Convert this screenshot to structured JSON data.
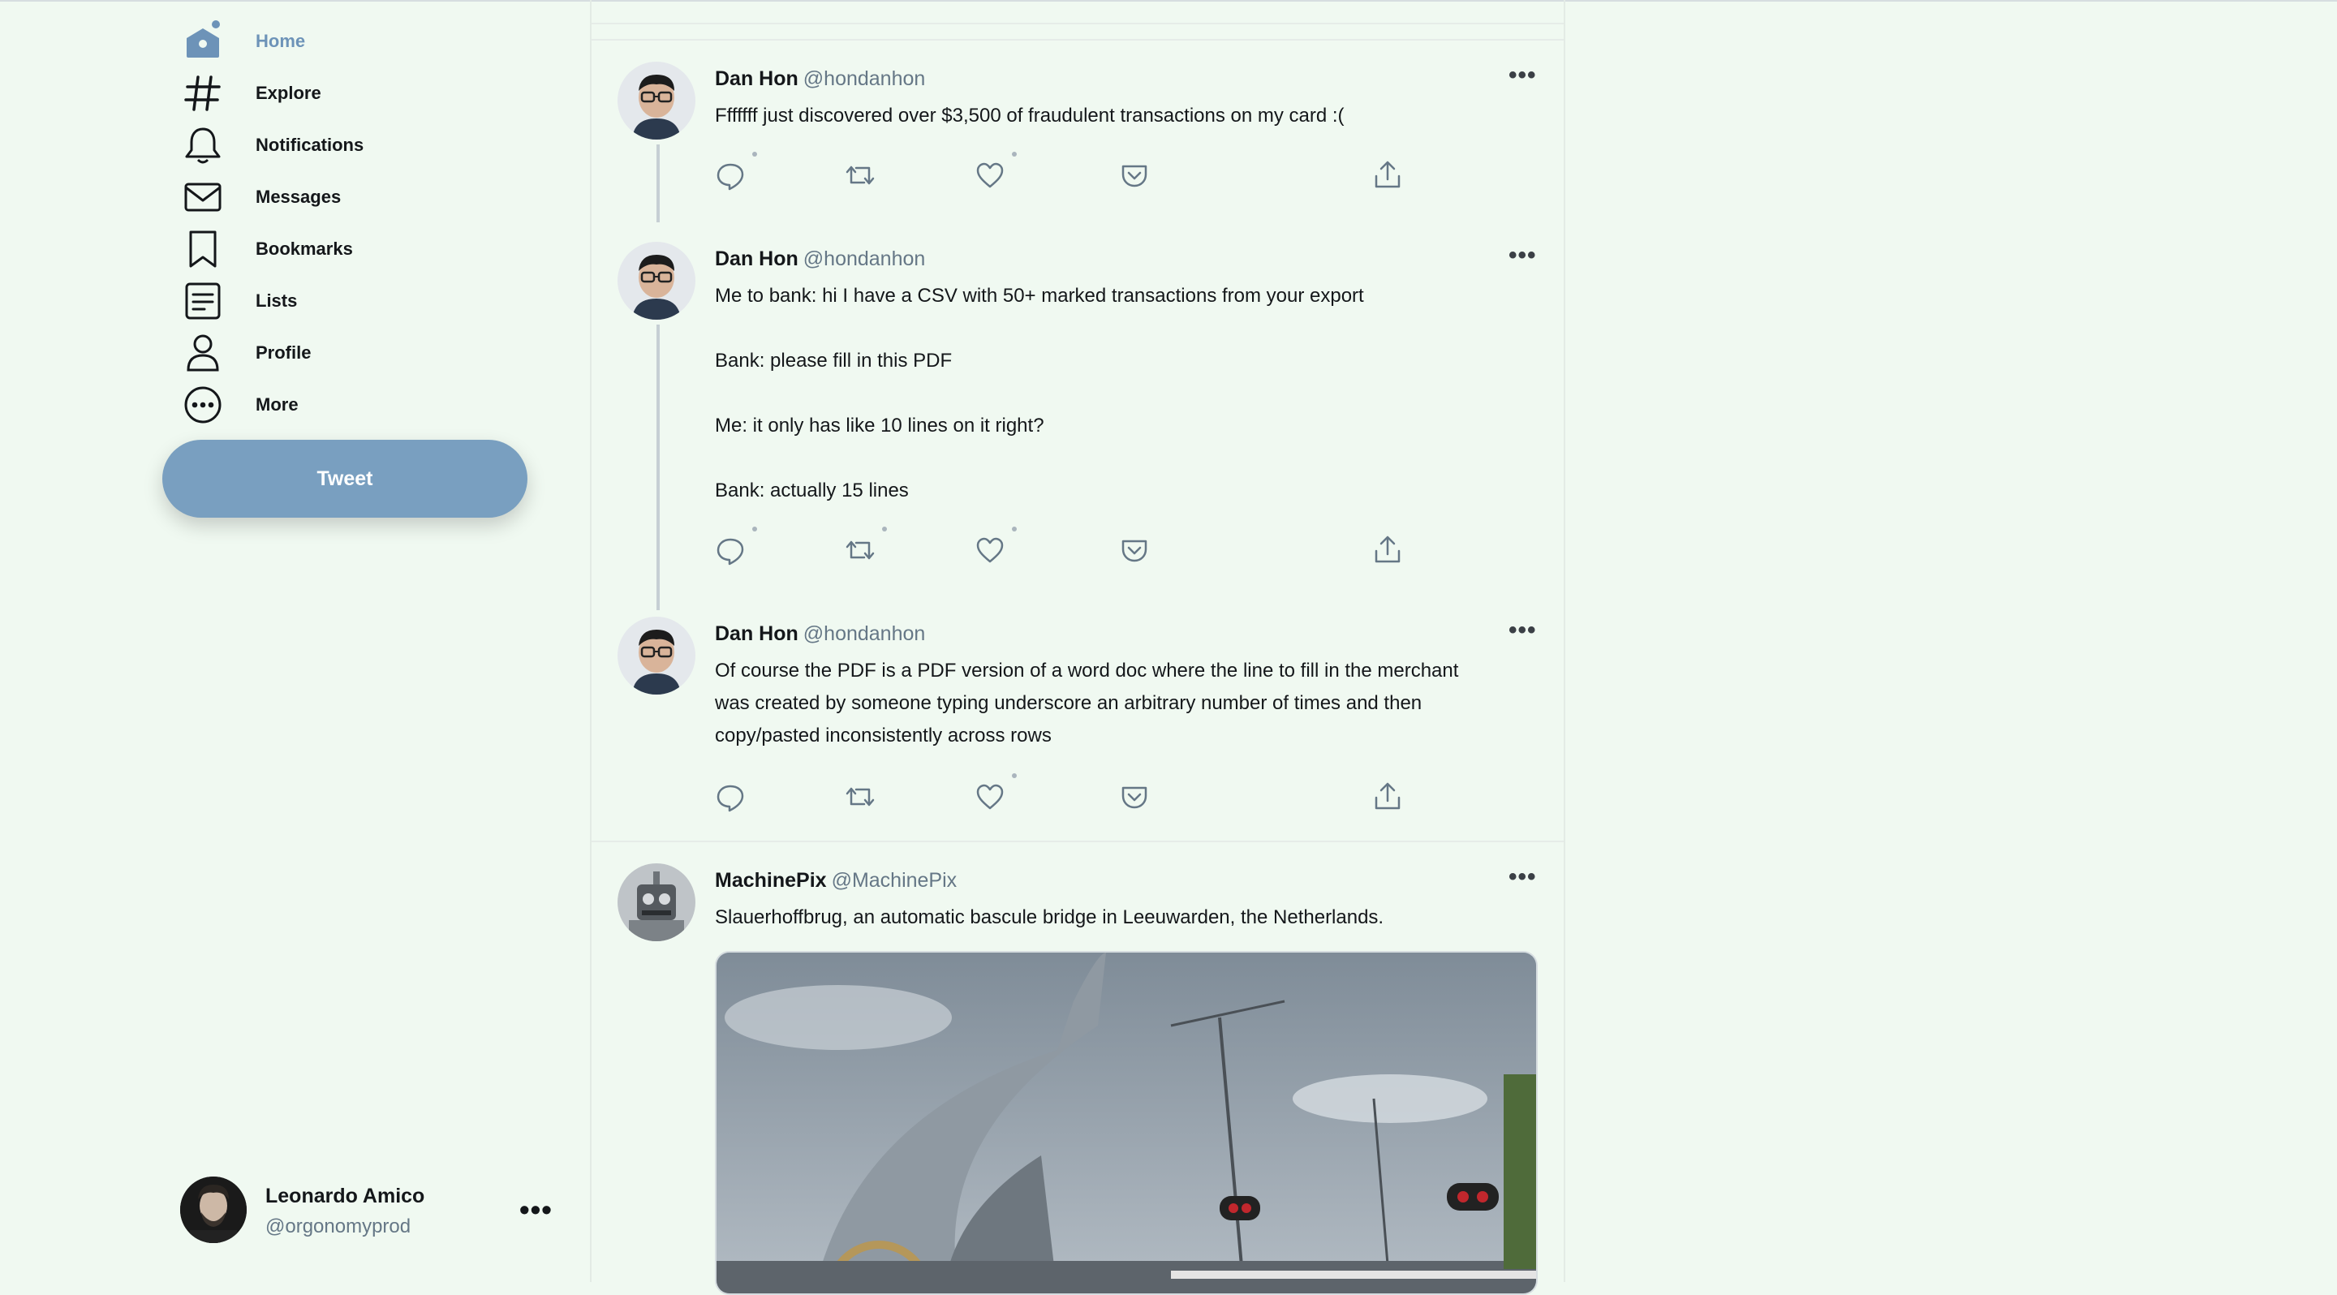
{
  "nav": {
    "items": [
      {
        "label": "Home",
        "icon": "home-icon",
        "active": true
      },
      {
        "label": "Explore",
        "icon": "hashtag-icon"
      },
      {
        "label": "Notifications",
        "icon": "bell-icon"
      },
      {
        "label": "Messages",
        "icon": "envelope-icon"
      },
      {
        "label": "Bookmarks",
        "icon": "bookmark-icon"
      },
      {
        "label": "Lists",
        "icon": "list-icon"
      },
      {
        "label": "Profile",
        "icon": "person-icon"
      },
      {
        "label": "More",
        "icon": "more-circle-icon"
      }
    ],
    "tweet_button": "Tweet"
  },
  "account": {
    "name": "Leonardo Amico",
    "handle": "@orgonomyprod",
    "more": "•••"
  },
  "tweets": [
    {
      "name": "Dan Hon",
      "handle": "@hondanhon",
      "lines": [
        "Fffffff just discovered over $3,500 of fraudulent transactions on my card :("
      ]
    },
    {
      "name": "Dan Hon",
      "handle": "@hondanhon",
      "lines": [
        "Me to bank: hi I have a CSV with 50+ marked transactions from your export",
        "Bank: please fill in this PDF",
        "Me: it only has like 10 lines on it right?",
        "Bank: actually 15 lines"
      ]
    },
    {
      "name": "Dan Hon",
      "handle": "@hondanhon",
      "lines": [
        "Of course the PDF is a PDF version of a word doc where the line to fill in the merchant",
        "was created by someone typing underscore an arbitrary number of times and then",
        "copy/pasted inconsistently across rows"
      ]
    },
    {
      "name": "MachinePix",
      "handle": "@MachinePix",
      "lines": [
        "Slauerhoffbrug, an automatic bascule bridge in Leeuwarden, the Netherlands."
      ]
    }
  ],
  "ui": {
    "more_dots": "•••",
    "accent_color": "#799fc0",
    "background_color": "#f0f9f1"
  }
}
